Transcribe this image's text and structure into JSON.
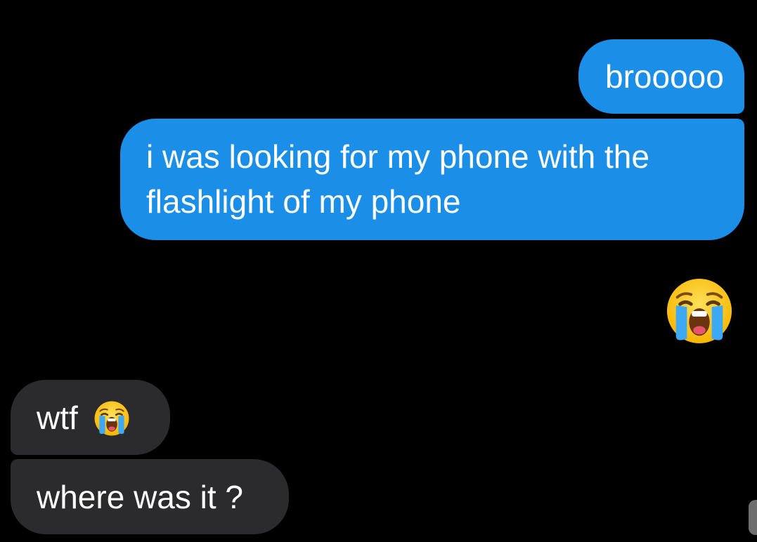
{
  "chat": {
    "messages": [
      {
        "sender": "me",
        "text": "brooooo"
      },
      {
        "sender": "me",
        "text": "i was looking for my phone with the flashlight of my phone"
      },
      {
        "sender": "me",
        "emoji": "loudly-crying-face"
      },
      {
        "sender": "them",
        "text": "wtf",
        "emoji": "loudly-crying-face"
      },
      {
        "sender": "them",
        "text": "where was it ?"
      }
    ]
  },
  "colors": {
    "background": "#000000",
    "sent_bubble": "#1b8ee8",
    "received_bubble": "#2b2b2d",
    "text": "#ffffff"
  }
}
